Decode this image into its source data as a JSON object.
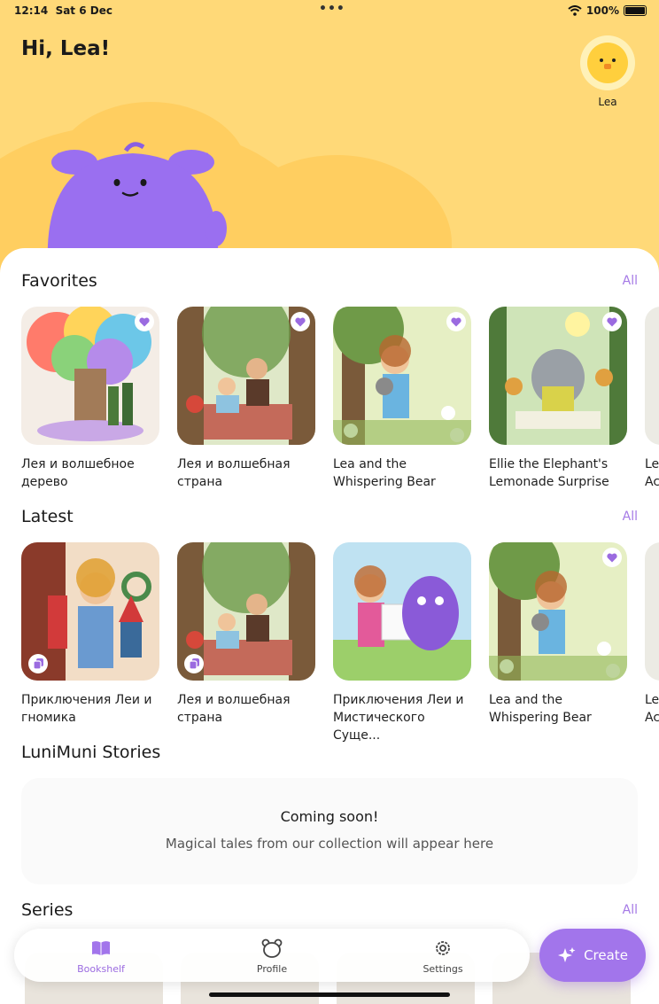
{
  "status": {
    "time": "12:14",
    "date": "Sat 6 Dec",
    "battery": "100%",
    "battery_level": 1.0
  },
  "header": {
    "greeting": "Hi, Lea!",
    "profile_name": "Lea"
  },
  "favorites": {
    "title": "Favorites",
    "all_label": "All",
    "items": [
      {
        "title": "Лея и волшебное дерево",
        "favorite": true
      },
      {
        "title": "Лея и волшебная страна",
        "favorite": true
      },
      {
        "title": "Lea and the Whispering Bear",
        "favorite": true
      },
      {
        "title": "Ellie the Elephant's Lemonade Surprise",
        "favorite": true
      },
      {
        "title": "Le Ac"
      }
    ]
  },
  "latest": {
    "title": "Latest",
    "all_label": "All",
    "items": [
      {
        "title": "Приключения Леи и гномика",
        "badge": "copy-icon"
      },
      {
        "title": "Лея и волшебная страна",
        "badge": "copy-icon"
      },
      {
        "title": "Приключения Леи и Мистического Суще..."
      },
      {
        "title": "Lea and the Whispering Bear",
        "favorite": true
      },
      {
        "title": "Le Ac"
      }
    ]
  },
  "lunimuni": {
    "title": "LuniMuni Stories",
    "coming_title": "Coming soon!",
    "coming_text": "Magical tales from our collection will appear here"
  },
  "series": {
    "title": "Series",
    "all_label": "All"
  },
  "tabbar": {
    "bookshelf": "Bookshelf",
    "profile": "Profile",
    "settings": "Settings",
    "create": "Create"
  },
  "colors": {
    "accent": "#a275eb",
    "hero": "#ffd978",
    "mascot": "#9a6ff0"
  }
}
